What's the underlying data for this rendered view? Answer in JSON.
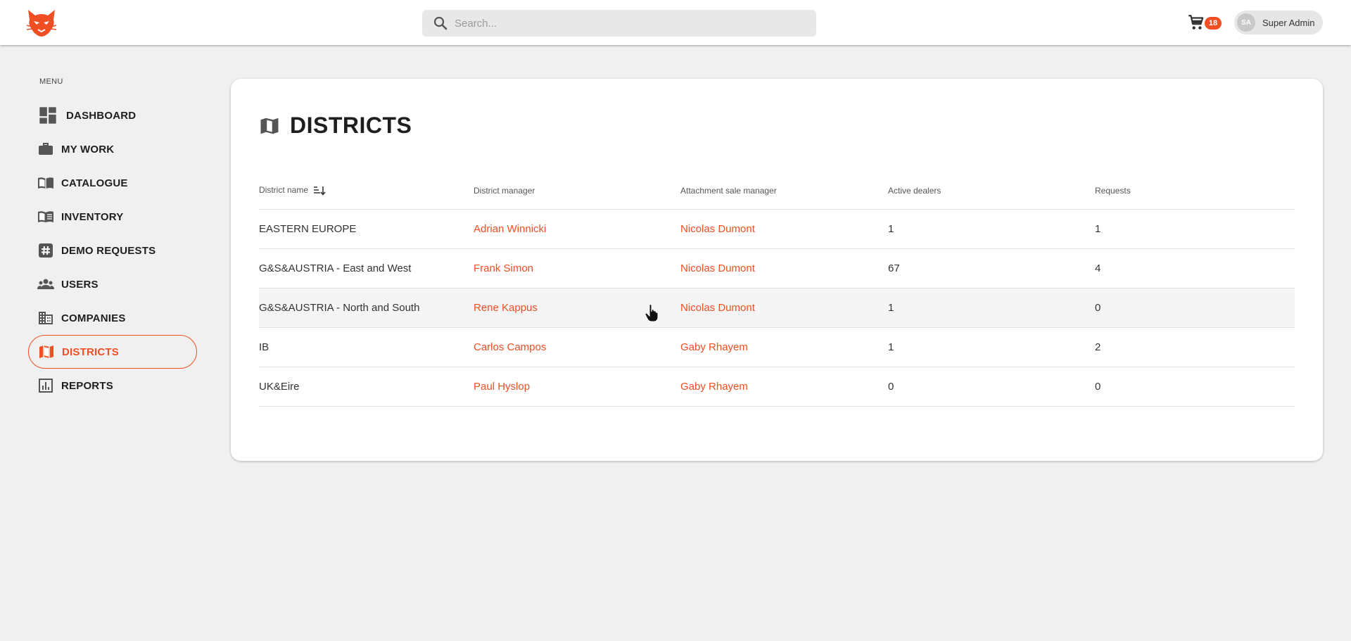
{
  "header": {
    "search_placeholder": "Search...",
    "cart_count": "18",
    "user_initials": "SA",
    "user_name": "Super Admin"
  },
  "sidebar": {
    "menu_title": "MENU",
    "items": [
      {
        "label": "DASHBOARD",
        "icon": "dashboard-icon",
        "active": false
      },
      {
        "label": "MY WORK",
        "icon": "briefcase-icon",
        "active": false
      },
      {
        "label": "CATALOGUE",
        "icon": "book-icon",
        "active": false
      },
      {
        "label": "INVENTORY",
        "icon": "menu-book-icon",
        "active": false
      },
      {
        "label": "DEMO REQUESTS",
        "icon": "hashtag-icon",
        "active": false
      },
      {
        "label": "USERS",
        "icon": "people-icon",
        "active": false
      },
      {
        "label": "COMPANIES",
        "icon": "building-icon",
        "active": false
      },
      {
        "label": "DISTRICTS",
        "icon": "map-icon",
        "active": true
      },
      {
        "label": "REPORTS",
        "icon": "chart-icon",
        "active": false
      }
    ]
  },
  "main": {
    "title": "DISTRICTS",
    "columns": [
      "District name",
      "District manager",
      "Attachment sale manager",
      "Active dealers",
      "Requests"
    ],
    "rows": [
      {
        "district": "EASTERN EUROPE",
        "manager": "Adrian Winnicki",
        "attachment_manager": "Nicolas Dumont",
        "active_dealers": "1",
        "requests": "1"
      },
      {
        "district": "G&S&AUSTRIA - East and West",
        "manager": "Frank Simon",
        "attachment_manager": "Nicolas Dumont",
        "active_dealers": "67",
        "requests": "4"
      },
      {
        "district": "G&S&AUSTRIA - North and South",
        "manager": "Rene Kappus",
        "attachment_manager": "Nicolas Dumont",
        "active_dealers": "1",
        "requests": "0"
      },
      {
        "district": "IB",
        "manager": "Carlos Campos",
        "attachment_manager": "Gaby Rhayem",
        "active_dealers": "1",
        "requests": "2"
      },
      {
        "district": "UK&Eire",
        "manager": "Paul Hyslop",
        "attachment_manager": "Gaby Rhayem",
        "active_dealers": "0",
        "requests": "0"
      }
    ]
  },
  "colors": {
    "accent": "#f04e23",
    "background": "#f0f0f0",
    "card": "#ffffff",
    "text": "#1e1e1e"
  }
}
